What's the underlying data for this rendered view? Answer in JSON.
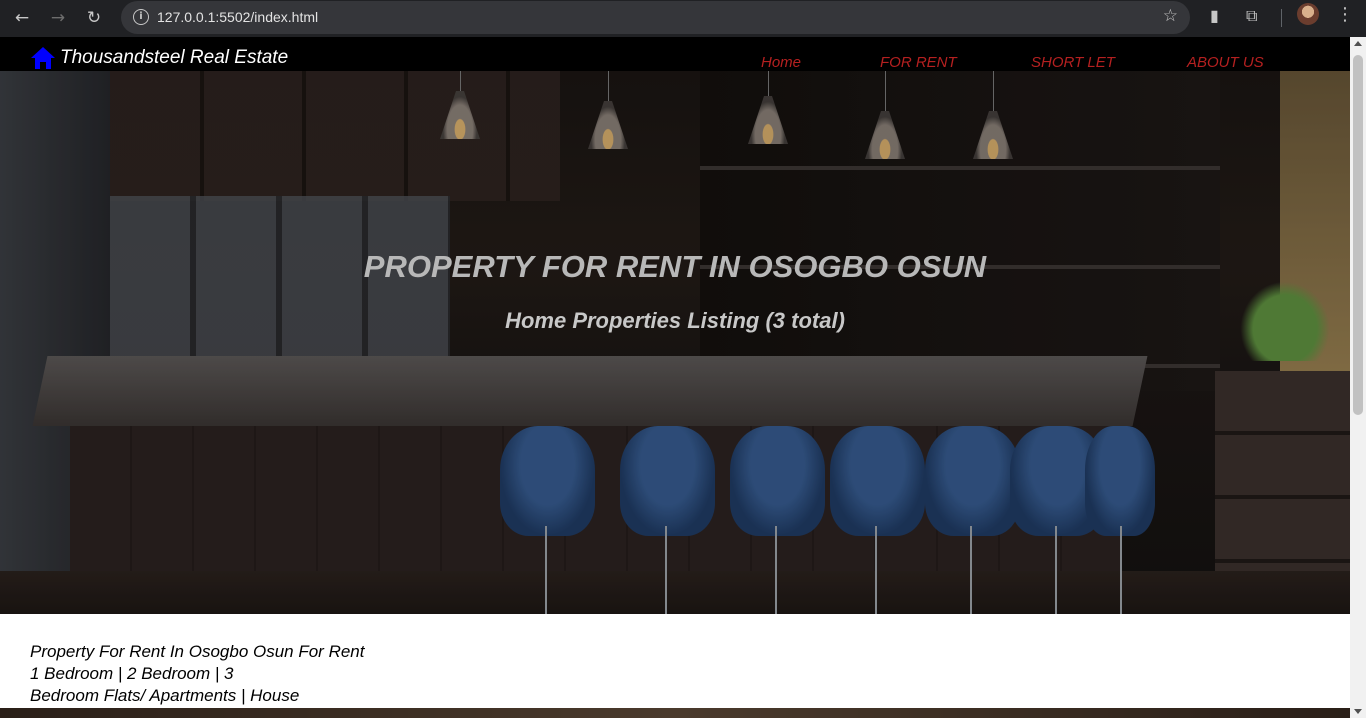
{
  "browser": {
    "url": "127.0.0.1:5502/index.html",
    "back_icon": "arrow-left-icon",
    "forward_icon": "arrow-right-icon",
    "reload_icon": "reload-icon",
    "info_icon": "info-icon",
    "bookmark_icon": "star-icon",
    "menu_icon": "kebab-menu-icon"
  },
  "site": {
    "brand": "Thousandsteel Real Estate",
    "brand_icon": "home-icon",
    "brand_icon_color": "#0000ff",
    "nav": [
      {
        "label": "Home"
      },
      {
        "label": "FOR RENT"
      },
      {
        "label": "SHORT LET"
      },
      {
        "label": "ABOUT US"
      }
    ],
    "nav_color": "#b52020"
  },
  "hero": {
    "title": "PROPERTY FOR RENT IN OSOGBO OSUN",
    "subtitle": "Home Properties Listing (3 total)"
  },
  "intro": {
    "line1": "Property For Rent In Osogbo Osun For Rent",
    "line2": "1 Bedroom | 2 Bedroom | 3",
    "line3": "Bedroom Flats/ Apartments | House"
  }
}
